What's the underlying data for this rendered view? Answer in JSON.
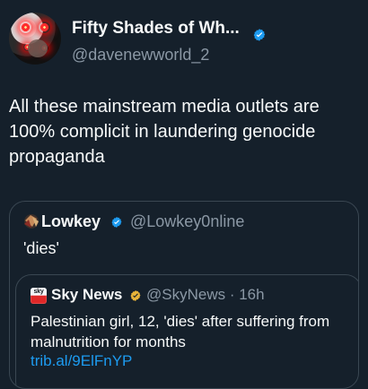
{
  "account": {
    "display_name": "Fifty Shades of Wh...",
    "handle": "@davenewworld_2"
  },
  "post": {
    "text": "All these mainstream media outlets are 100% complicit in laundering genocide propaganda"
  },
  "quote": {
    "name": "Lowkey",
    "handle": "@Lowkey0nline",
    "text": "'dies'"
  },
  "embedded_quote": {
    "name": "Sky News",
    "handle_time": "@SkyNews · 16h",
    "text": "Palestinian girl, 12, 'dies' after suffering from malnutrition for months",
    "link": "trib.al/9ElFnYP",
    "logo_text": "sky"
  },
  "colors": {
    "background": "#15202b",
    "primary_text": "#f7f9f9",
    "secondary_text": "#8b98a5",
    "accent": "#1d9bf0"
  },
  "icons": {
    "verified": "blue-check-badge",
    "business": "gold-check-badge"
  }
}
